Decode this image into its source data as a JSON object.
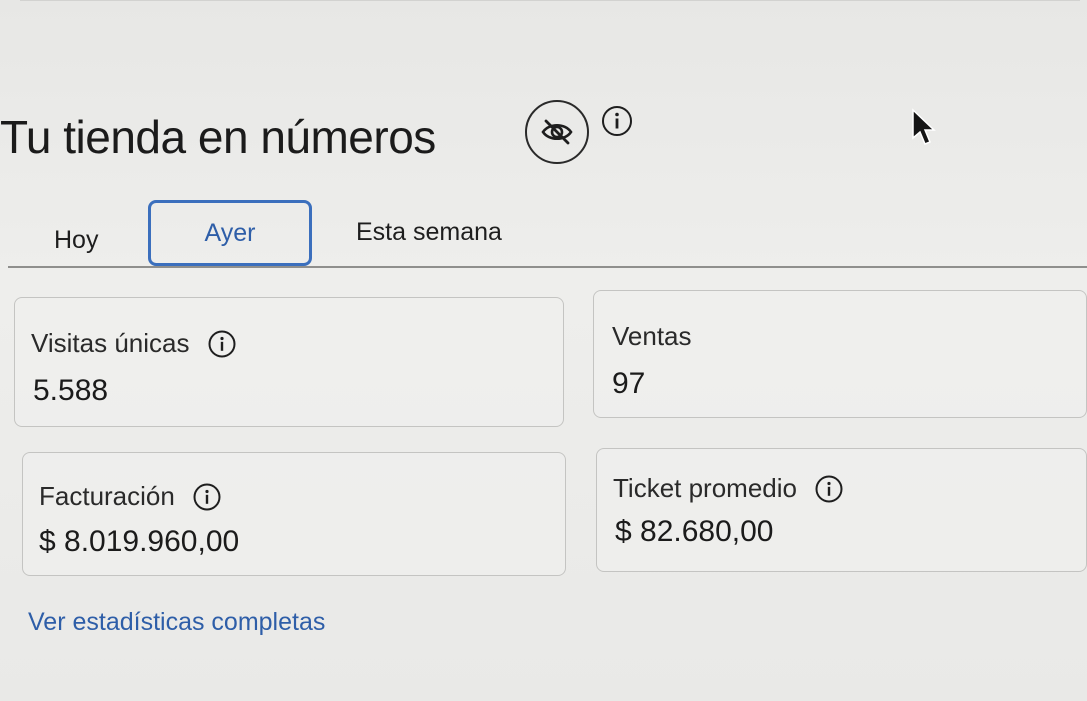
{
  "header": {
    "title": "Tu tienda en números",
    "visibility_icon": "eye-slash-icon",
    "info_icon": "info-icon"
  },
  "tabs": [
    {
      "label": "Hoy",
      "active": false
    },
    {
      "label": "Ayer",
      "active": true
    },
    {
      "label": "Esta semana",
      "active": false
    }
  ],
  "metrics": [
    {
      "label": "Visitas únicas",
      "value": "5.588",
      "has_info": true
    },
    {
      "label": "Ventas",
      "value": "97",
      "has_info": false
    },
    {
      "label": "Facturación",
      "value": "$ 8.019.960,00",
      "has_info": true
    },
    {
      "label": "Ticket promedio",
      "value": "$ 82.680,00",
      "has_info": true
    }
  ],
  "footer": {
    "link_label": "Ver estadísticas completas"
  },
  "colors": {
    "accent": "#2e5ea8",
    "active_tab_border": "#3b6fbd",
    "text": "#1e1e1e",
    "background": "#ececea"
  }
}
